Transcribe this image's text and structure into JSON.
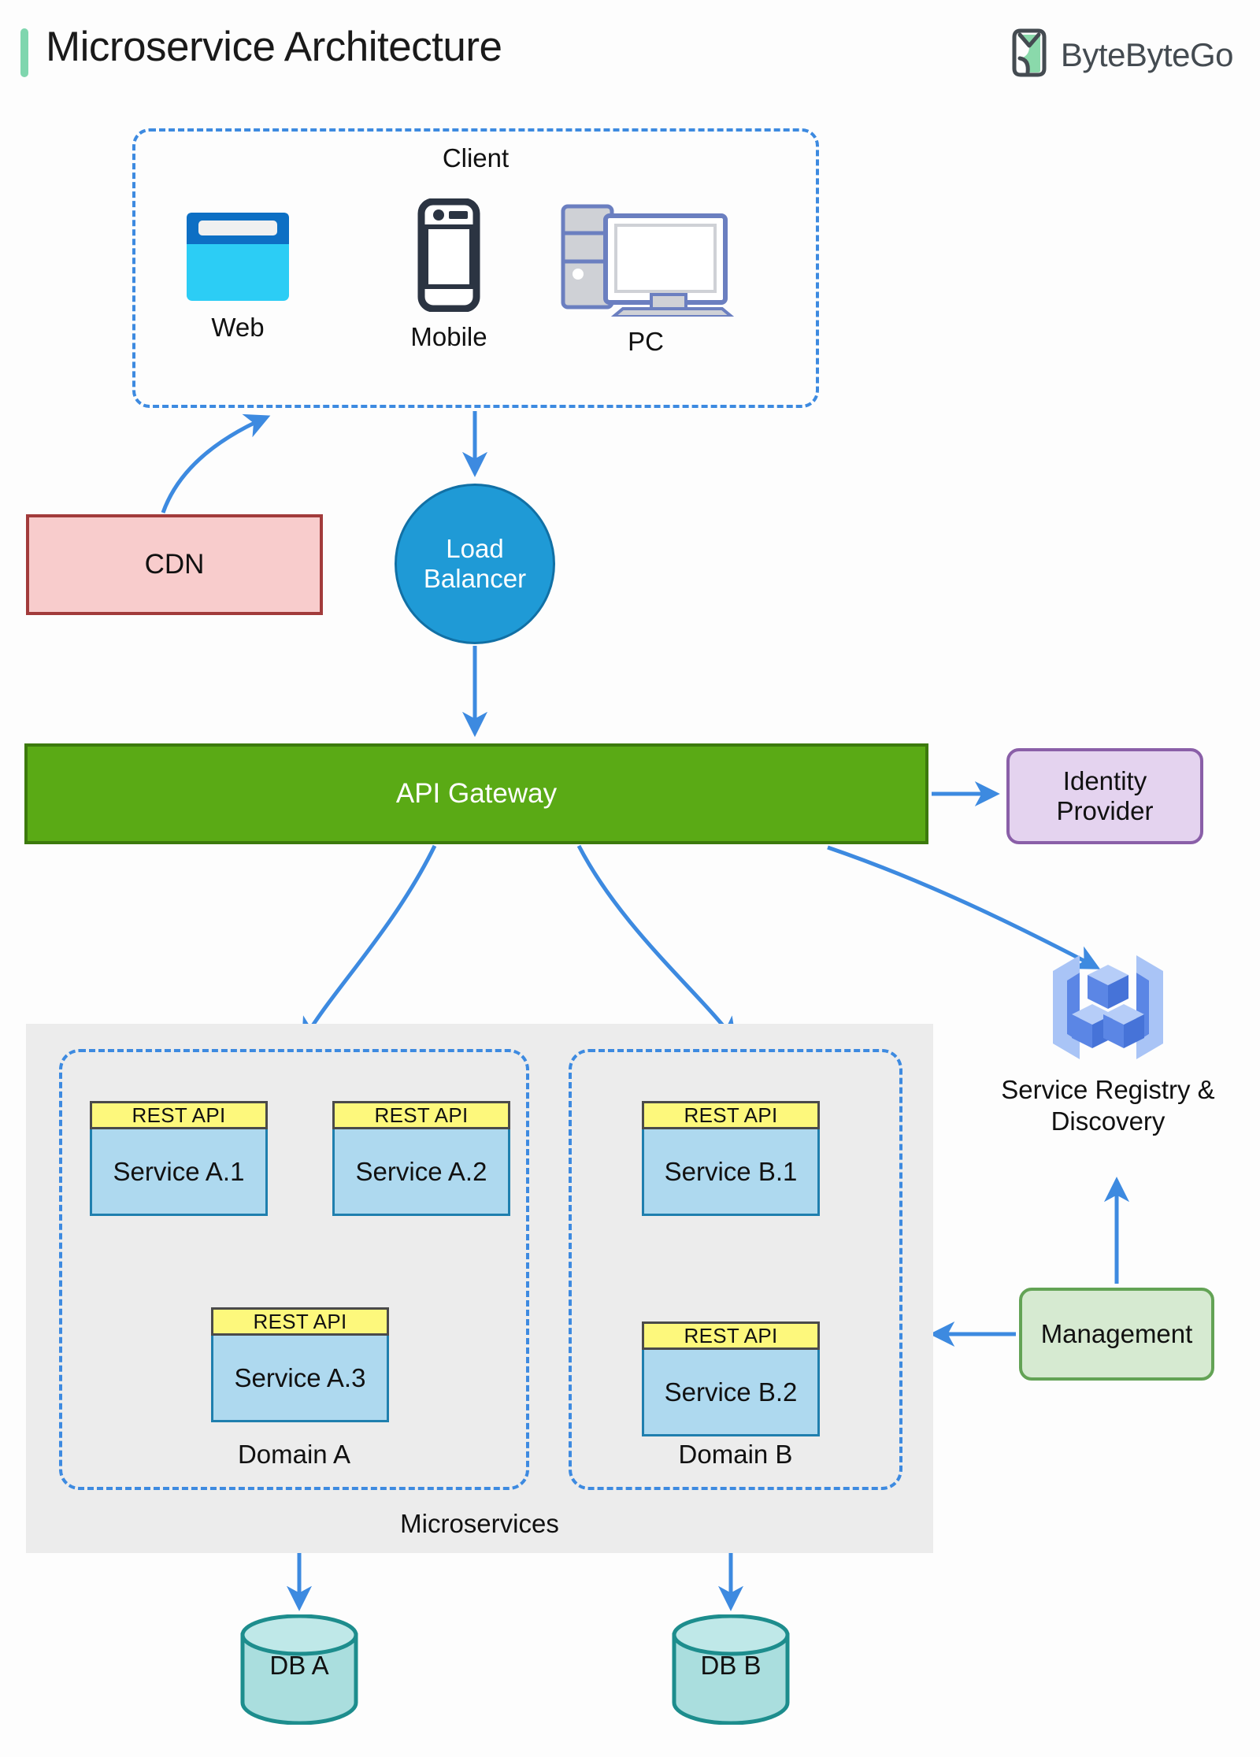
{
  "header": {
    "title": "Microservice Architecture",
    "brand": "ByteByteGo",
    "accent_color": "#7fd6ae",
    "brand_text_color": "#444b51"
  },
  "client": {
    "label": "Client",
    "items": [
      {
        "label": "Web",
        "icon": "browser-window-icon"
      },
      {
        "label": "Mobile",
        "icon": "mobile-phone-icon"
      },
      {
        "label": "PC",
        "icon": "desktop-computer-icon"
      }
    ],
    "border_color": "#3d8ae0"
  },
  "cdn": {
    "label": "CDN",
    "fill": "#f8cccc",
    "border": "#a23b3b"
  },
  "load_balancer": {
    "line1": "Load",
    "line2": "Balancer",
    "fill": "#1f9ad6",
    "border": "#1170a5",
    "text_color": "#ffffff"
  },
  "api_gateway": {
    "label": "API Gateway",
    "fill": "#5aaa15",
    "border": "#3c7a0c",
    "text_color": "#ffffff"
  },
  "identity_provider": {
    "line1": "Identity",
    "line2": "Provider",
    "fill": "#e4d3ef",
    "border": "#8a5fa8"
  },
  "service_registry": {
    "line1": "Service Registry &",
    "line2": "Discovery",
    "icon": "service-registry-cubes-icon",
    "icon_color": "#5b86e5"
  },
  "management": {
    "label": "Management",
    "fill": "#d6ead1",
    "border": "#63a355"
  },
  "microservices": {
    "label": "Microservices",
    "container_fill": "#ececec",
    "rest_api_label": "REST API",
    "rest_api_fill": "#fdf87c",
    "rest_api_border": "#4a4a4a",
    "service_fill": "#aed9ef",
    "service_border": "#1f7fae",
    "domains": [
      {
        "label": "Domain A",
        "services": [
          "Service A.1",
          "Service A.2",
          "Service A.3"
        ]
      },
      {
        "label": "Domain B",
        "services": [
          "Service B.1",
          "Service B.2"
        ]
      }
    ]
  },
  "databases": [
    {
      "label": "DB A",
      "fill": "#aadede",
      "border": "#1d8d8d"
    },
    {
      "label": "DB B",
      "fill": "#aadede",
      "border": "#1d8d8d"
    }
  ],
  "edges": {
    "color": "#3d8ae0",
    "connections": [
      "CDN -> Client",
      "Client -> Load Balancer",
      "Load Balancer -> API Gateway",
      "API Gateway -> Identity Provider",
      "API Gateway -> Domain A",
      "API Gateway -> Domain B",
      "API Gateway -> Service Registry & Discovery",
      "Management -> Service Registry & Discovery",
      "Management -> Domain B",
      "Domain A -> DB A",
      "Domain B -> DB B"
    ]
  }
}
